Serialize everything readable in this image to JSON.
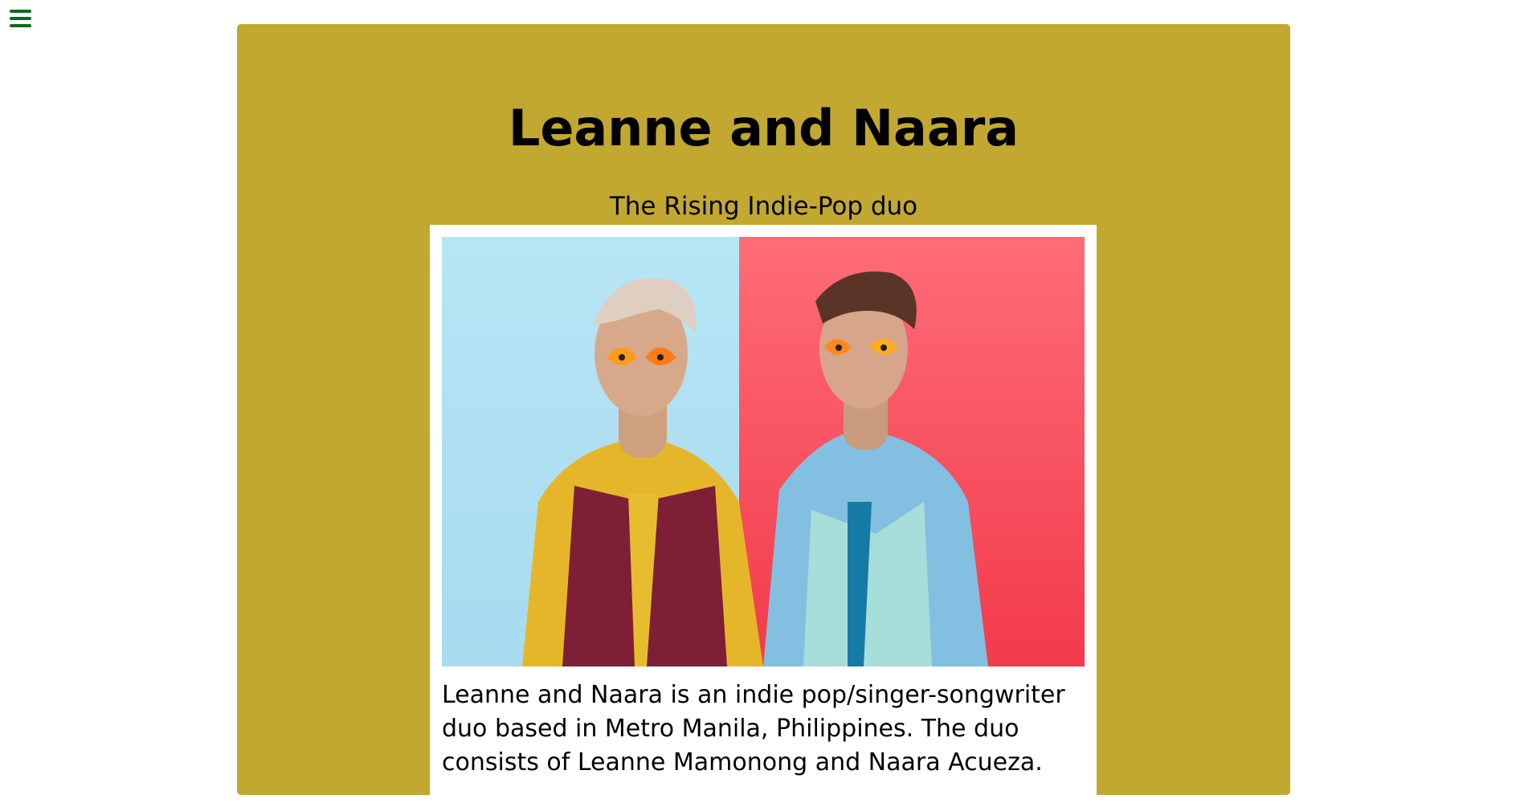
{
  "page": {
    "title": "Leanne and Naara",
    "subtitle": "The Rising Indie-Pop duo",
    "description": "Leanne and Naara is an indie pop/singer-songwriter duo based in Metro Manila, Philippines. The duo consists of Leanne Mamonong and Naara Acueza."
  },
  "nav": {
    "menu_icon": "hamburger-menu-icon"
  },
  "colors": {
    "panel_background": "#c2a830",
    "menu_icon": "#0f6b1d",
    "card_background": "#ffffff"
  }
}
